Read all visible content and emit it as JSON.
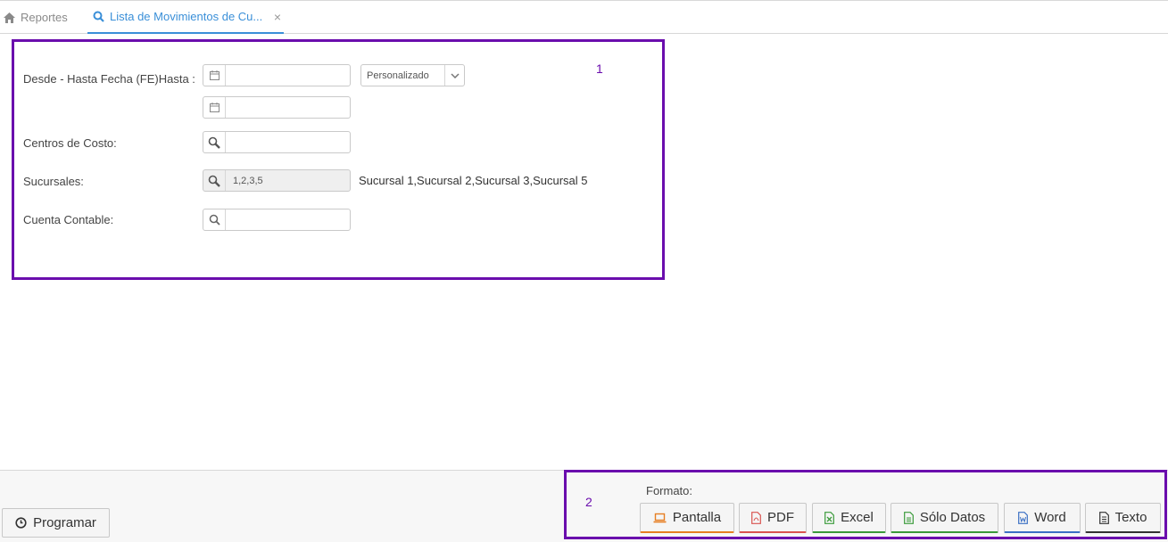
{
  "tabs": {
    "home_label": "Reportes",
    "active_label": "Lista de Movimientos de Cu...",
    "close_glyph": "×"
  },
  "markers": {
    "box1": "1",
    "box2": "2"
  },
  "form": {
    "date_label": "Desde - Hasta Fecha (FE)Hasta :",
    "date_from_value": "",
    "date_to_value": "",
    "range_select": "Personalizado",
    "cost_center_label": "Centros de Costo:",
    "cost_center_value": "",
    "branches_label": "Sucursales:",
    "branches_value": "1,2,3,5",
    "branches_desc": "Sucursal 1,Sucursal 2,Sucursal 3,Sucursal 5",
    "account_label": "Cuenta Contable:",
    "account_value": ""
  },
  "footer": {
    "schedule_label": "Programar",
    "format_label": "Formato:",
    "buttons": {
      "pantalla": "Pantalla",
      "pdf": "PDF",
      "excel": "Excel",
      "solo_datos": "Sólo Datos",
      "word": "Word",
      "texto": "Texto"
    }
  },
  "colors": {
    "accent": "#3a8fd8",
    "annotation": "#6a0dad",
    "pantalla": "#e67e22",
    "pdf": "#d9534f",
    "excel": "#3a9a3a",
    "word": "#3a6fc4",
    "texto": "#333333"
  }
}
